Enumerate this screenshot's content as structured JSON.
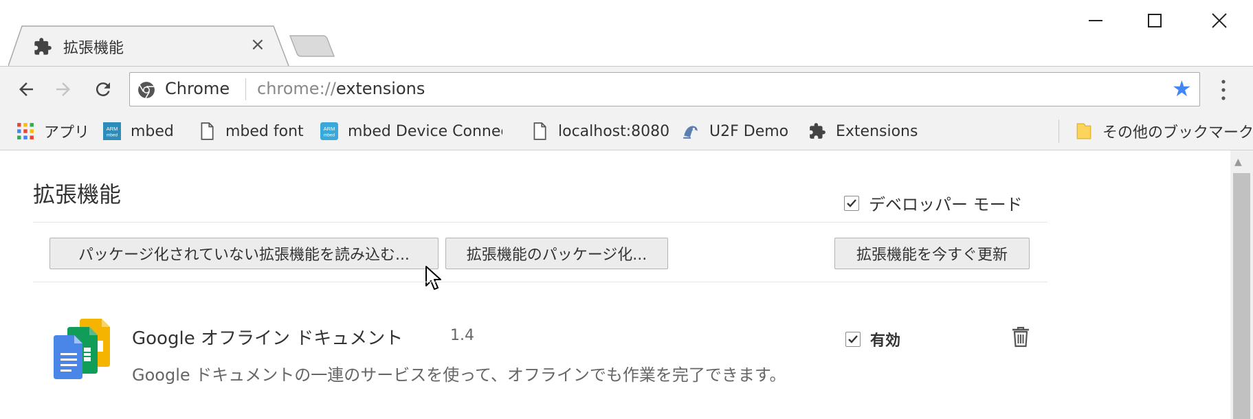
{
  "browser": {
    "tab": {
      "title": "拡張機能",
      "close_glyph": "×",
      "icon": "puzzle-icon"
    },
    "window_controls": {
      "minimize": "—",
      "maximize": "☐",
      "close": "✕"
    },
    "omnibox": {
      "chip_label": "Chrome",
      "url_scheme": "chrome://",
      "url_path": "extensions",
      "bookmarked": true
    },
    "bookmarks": [
      {
        "label": "アプリ",
        "icon": "apps-grid-icon"
      },
      {
        "label": "mbed",
        "icon": "arm-mbed-icon"
      },
      {
        "label": "mbed font",
        "icon": "page-icon"
      },
      {
        "label": "mbed Device Connec",
        "icon": "arm-mbed-icon"
      },
      {
        "label": "localhost:8080",
        "icon": "page-icon"
      },
      {
        "label": "U2F Demo",
        "icon": "u2f-icon"
      },
      {
        "label": "Extensions",
        "icon": "puzzle-icon"
      }
    ],
    "other_bookmarks": {
      "label": "その他のブックマーク",
      "icon": "folder-icon"
    }
  },
  "page": {
    "title": "拡張機能",
    "developer_mode": {
      "label": "デベロッパー モード",
      "checked": true
    },
    "buttons": {
      "load_unpacked": "パッケージ化されていない拡張機能を読み込む...",
      "pack_extension": "拡張機能のパッケージ化...",
      "update_now": "拡張機能を今すぐ更新"
    },
    "extension": {
      "name": "Google オフライン ドキュメント",
      "version": "1.4",
      "description": "Google ドキュメントの一連のサービスを使って、オフラインでも作業を完了できます。",
      "enabled_label": "有効",
      "enabled": true
    }
  },
  "colors": {
    "accent": "#4285f4",
    "chrome_bg": "#f2f2f2",
    "docs_blue": "#4a86e8",
    "sheets_green": "#0f9d58",
    "slides_yellow": "#f4b400"
  }
}
